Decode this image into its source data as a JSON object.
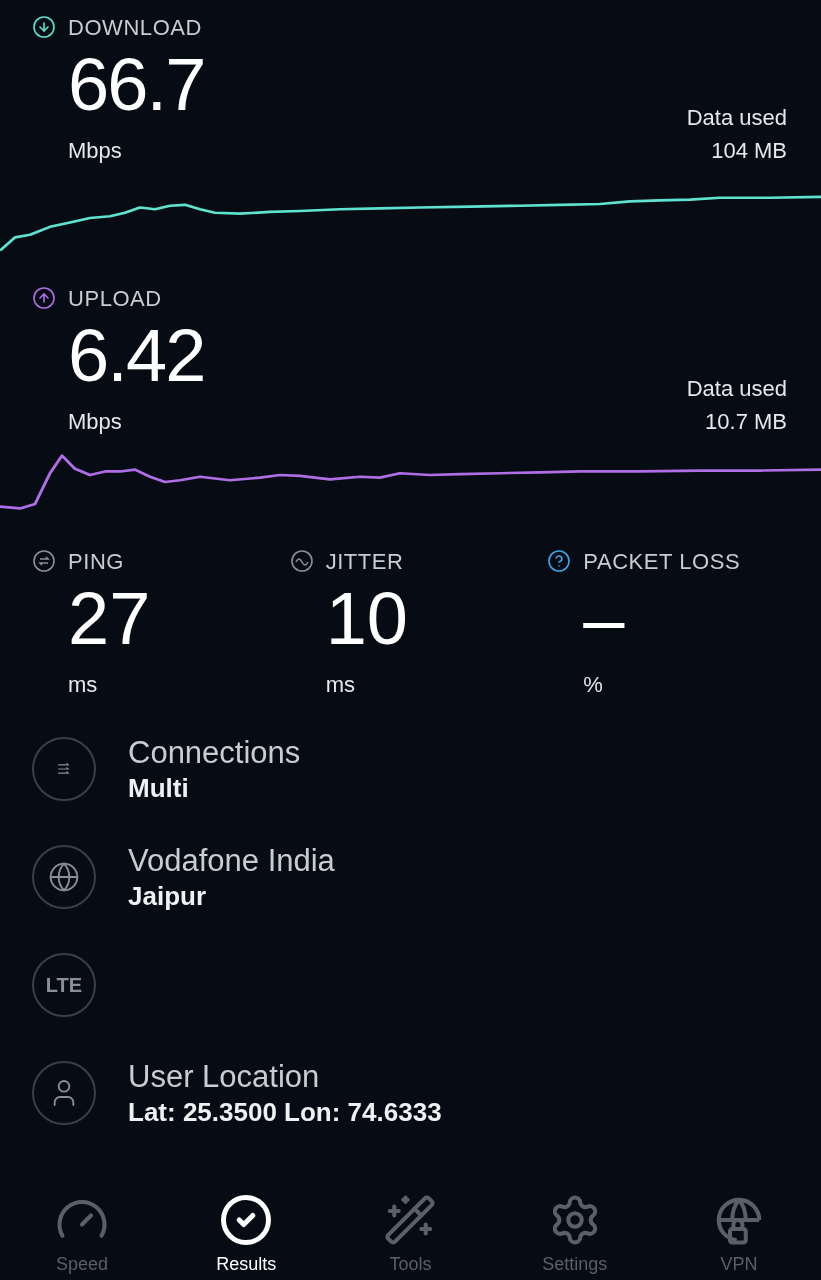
{
  "results": [
    {
      "kind": "download",
      "label": "DOWNLOAD",
      "value": "66.7",
      "unit": "Mbps",
      "data_used_label": "Data used",
      "data_used": "104 MB"
    },
    {
      "kind": "upload",
      "label": "UPLOAD",
      "value": "6.42",
      "unit": "Mbps",
      "data_used_label": "Data used",
      "data_used": "10.7 MB"
    }
  ],
  "metrics": [
    {
      "kind": "ping",
      "label": "PING",
      "value": "27",
      "unit": "ms"
    },
    {
      "kind": "jitter",
      "label": "JITTER",
      "value": "10",
      "unit": "ms"
    },
    {
      "kind": "packet_loss",
      "label": "PACKET LOSS",
      "value": "–",
      "unit": "%"
    }
  ],
  "details": [
    {
      "kind": "connections",
      "title": "Connections",
      "value": "Multi"
    },
    {
      "kind": "provider",
      "title": "Vodafone India",
      "value": "Jaipur"
    },
    {
      "kind": "network",
      "badge": "LTE"
    },
    {
      "kind": "location",
      "title": "User Location",
      "value": "Lat: 25.3500 Lon: 74.6333"
    }
  ],
  "nav": [
    {
      "kind": "speed",
      "label": "Speed",
      "selected": false
    },
    {
      "kind": "results",
      "label": "Results",
      "selected": true
    },
    {
      "kind": "tools",
      "label": "Tools",
      "selected": false
    },
    {
      "kind": "settings",
      "label": "Settings",
      "selected": false
    },
    {
      "kind": "vpn",
      "label": "VPN",
      "selected": false
    }
  ]
}
